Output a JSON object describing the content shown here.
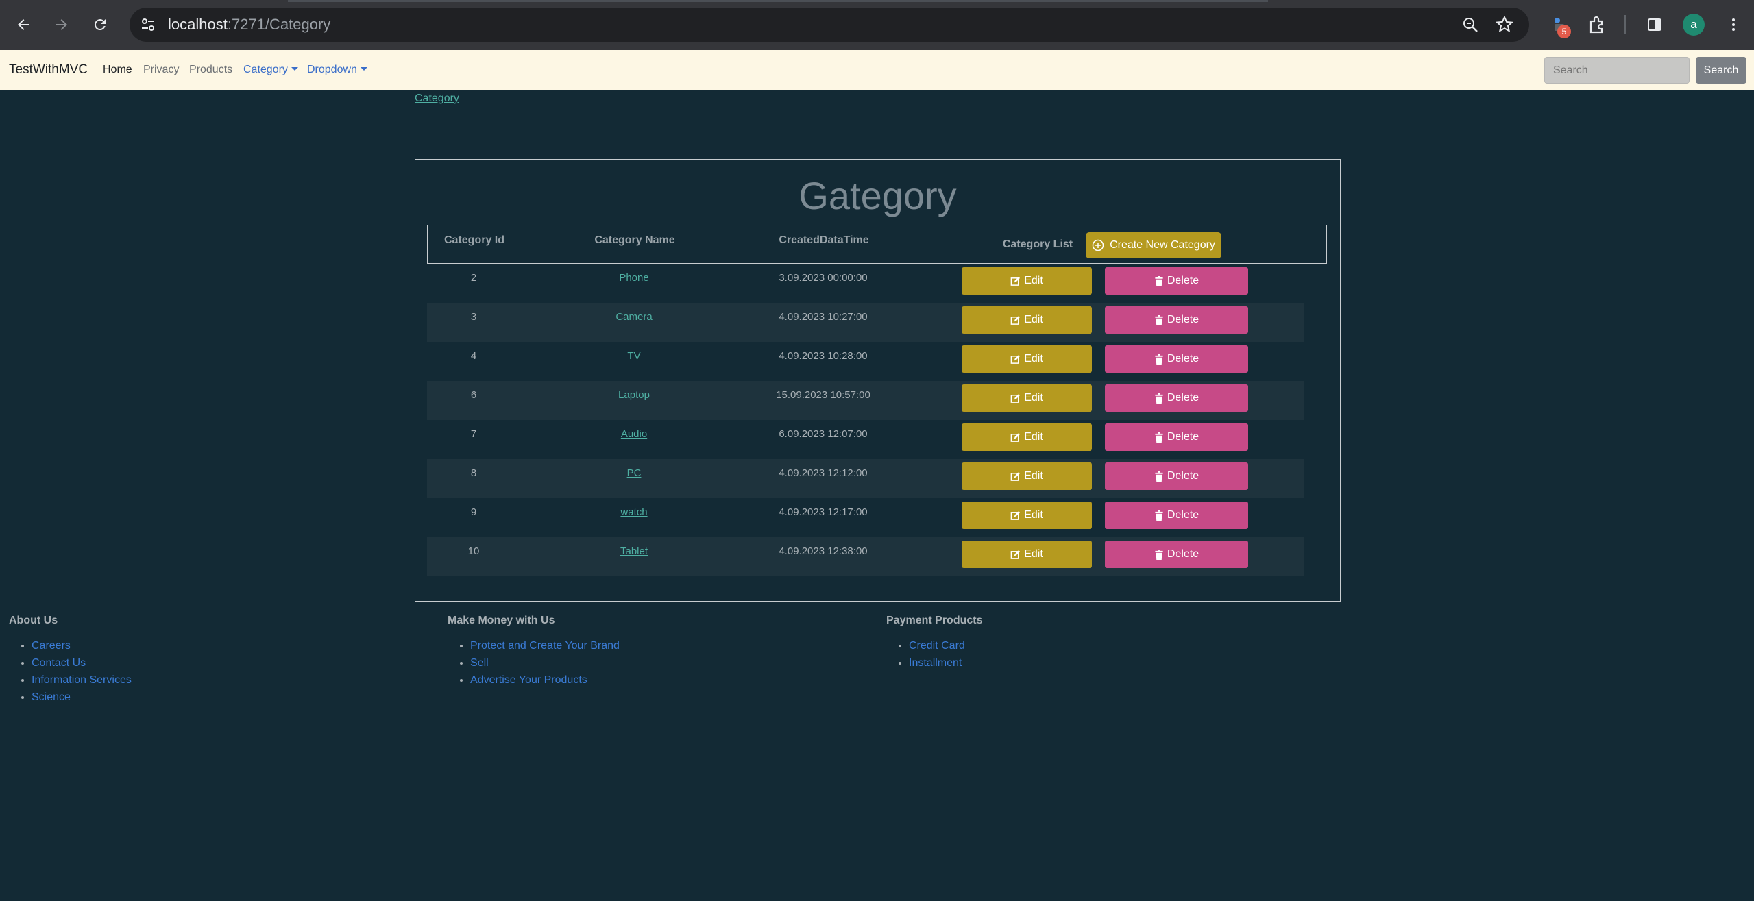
{
  "browser": {
    "url_host": "localhost",
    "url_path": ":7271/Category",
    "extension_badge": "5",
    "avatar_letter": "a"
  },
  "navbar": {
    "brand": "TestWithMVC",
    "links": {
      "home": "Home",
      "privacy": "Privacy",
      "products": "Products",
      "category": "Category",
      "dropdown": "Dropdown"
    },
    "search_placeholder": "Search",
    "search_button": "Search"
  },
  "breadcrumb": "Category",
  "card": {
    "title": "Gategory",
    "headers": {
      "id": "Category Id",
      "name": "Category Name",
      "created": "CreatedDataTime",
      "list": "Category List"
    },
    "create_button": "Create New Category",
    "edit_label": "Edit",
    "delete_label": "Delete",
    "rows": [
      {
        "id": "2",
        "name": "Phone",
        "created": "3.09.2023 00:00:00"
      },
      {
        "id": "3",
        "name": "Camera",
        "created": "4.09.2023 10:27:00"
      },
      {
        "id": "4",
        "name": "TV",
        "created": "4.09.2023 10:28:00"
      },
      {
        "id": "6",
        "name": "Laptop",
        "created": "15.09.2023 10:57:00"
      },
      {
        "id": "7",
        "name": "Audio",
        "created": "6.09.2023 12:07:00"
      },
      {
        "id": "8",
        "name": "PC",
        "created": "4.09.2023 12:12:00"
      },
      {
        "id": "9",
        "name": "watch",
        "created": "4.09.2023 12:17:00"
      },
      {
        "id": "10",
        "name": "Tablet",
        "created": "4.09.2023 12:38:00"
      }
    ]
  },
  "footer": {
    "about": {
      "heading": "About Us",
      "items": [
        "Careers",
        "Contact Us",
        "Information Services",
        "Science"
      ]
    },
    "money": {
      "heading": "Make Money with Us",
      "items": [
        "Protect and Create Your Brand",
        "Sell",
        "Advertise Your Products"
      ]
    },
    "payment": {
      "heading": "Payment Products",
      "items": [
        "Credit Card",
        "Installment"
      ]
    }
  },
  "colors": {
    "page_bg": "#132a35",
    "navbar_bg": "#fdf7e4",
    "edit": "#b59a1f",
    "delete": "#c74a87",
    "link": "#4fb0a3"
  }
}
